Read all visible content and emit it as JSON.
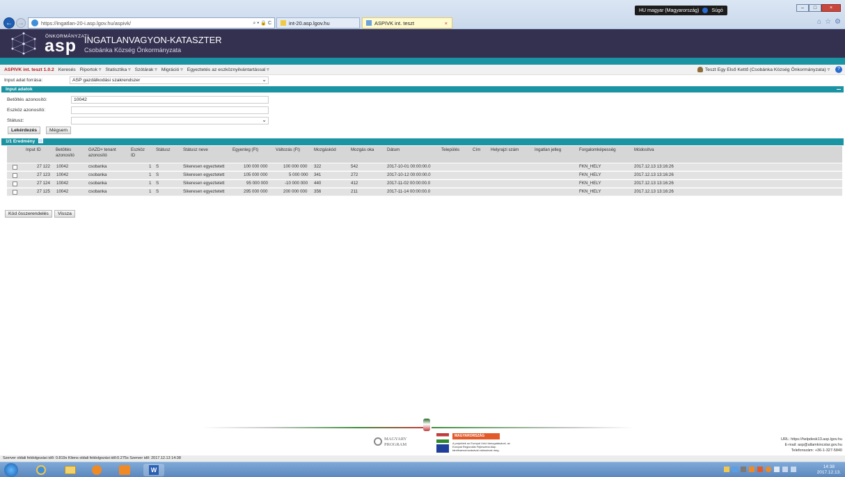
{
  "browser": {
    "url": "https://ingatlan-20-i.asp.lgov.hu/aspivk/",
    "tools": "⌕ ▾ 🔒 C",
    "tabs": [
      {
        "label": "int-20.asp.lgov.hu"
      },
      {
        "label": "ASPIVK int. teszt"
      }
    ],
    "language": "HU magyar (Magyarország)",
    "help": "Súgó"
  },
  "header": {
    "logo_small": "ÖNKORMÁNYZATI",
    "logo_big": "asp",
    "title": "INGATLANVAGYON-KATASZTER",
    "subtitle": "Csobánka Község Önkormányzata"
  },
  "menu": {
    "brand": "ASPIVK int. teszt 1.0.2",
    "items": [
      "Keresés",
      "Riportok ▿",
      "Statisztika ▿",
      "Szótárak ▿",
      "Migráció ▿",
      "Egyeztetés az eszköznyilvántartással ▿"
    ],
    "user": "Teszt Egy Első Kettő (Csobánka Község Önkormányzata) ▿"
  },
  "source": {
    "label": "Input adat forrása:",
    "value": "ASP gazdálkodási szakrendszer"
  },
  "input_section": {
    "title": "Input adatok",
    "betoltes_label": "Betöltés azonosító:",
    "betoltes_value": "10042",
    "eszkoz_label": "Eszköz azonosító:",
    "eszkoz_value": "",
    "status_label": "Státusz:",
    "status_value": "",
    "query_button": "Lekérdezés",
    "cancel_button": "Mégsem"
  },
  "results": {
    "title": "1/1  Eredmény",
    "headers": [
      "Input ID",
      "Betöltés azonosító",
      "GAZD+ tenant azonosító",
      "Eszköz ID",
      "Státusz",
      "Státusz neve",
      "Egyenleg (Ft)",
      "Változás (Ft)",
      "Mozgáskód",
      "Mozgás oka",
      "Dátum",
      "Település",
      "Cím",
      "Helyrajzi szám",
      "Ingatlan jelleg",
      "Forgalomképesség",
      "Módosítva"
    ],
    "rows": [
      [
        "27 122",
        "10042",
        "csobanka",
        "1",
        "S",
        "Sikeresen egyeztetett",
        "100 000 000",
        "100 000 000",
        "322",
        "542",
        "2017-10-01 00:00:00.0",
        "",
        "",
        "",
        "",
        "FKN_HELY",
        "2017.12.13 13:16:26"
      ],
      [
        "27 123",
        "10042",
        "csobanka",
        "1",
        "S",
        "Sikeresen egyeztetett",
        "105 000 000",
        "5 000 000",
        "341",
        "272",
        "2017-10-12 00:00:00.0",
        "",
        "",
        "",
        "",
        "FKN_HELY",
        "2017.12.13 13:16:26"
      ],
      [
        "27 124",
        "10042",
        "csobanka",
        "1",
        "S",
        "Sikeresen egyeztetett",
        "95 000 000",
        "-10 000 000",
        "440",
        "412",
        "2017-11-02 00:00:00.0",
        "",
        "",
        "",
        "",
        "FKN_HELY",
        "2017.12.13 13:16:26"
      ],
      [
        "27 125",
        "10042",
        "csobanka",
        "1",
        "S",
        "Sikeresen egyeztetett",
        "295 000 000",
        "200 000 000",
        "356",
        "211",
        "2017-11-14 00:00:00.0",
        "",
        "",
        "",
        "",
        "FKN_HELY",
        "2017.12.13 13:16:26"
      ]
    ]
  },
  "actions": {
    "assign": "Kód összerendelés",
    "back": "Vissza"
  },
  "footer": {
    "program": "MAGYARY PROGRAM",
    "hungary_logo": "MAGYARORSZÁG MEGÚJUL",
    "eu_text": "A projektek az Európai Unió támogatásával, az Európai Regionális Fejlesztési Alap társfinanszírozásával valósulnak meg.",
    "url_label": "URL: https://helpdesk13.asp.lgov.hu",
    "email_label": "E-mail: asp@allamkincstar.gov.hu",
    "phone_label": "Telefonszám: +36-1-327-5840"
  },
  "statusbar": "Szerver oldali feldolgozási idő: 0.819s Kliens oldali feldolgozási idő:0.275s   Szerver idő: 2017.12.13 14:38",
  "taskbar": {
    "time": "14:38",
    "date": "2017.12.13."
  },
  "colors": {
    "header_bg": "#333050",
    "teal": "#1a93a2",
    "brand_red": "#b3191c"
  }
}
